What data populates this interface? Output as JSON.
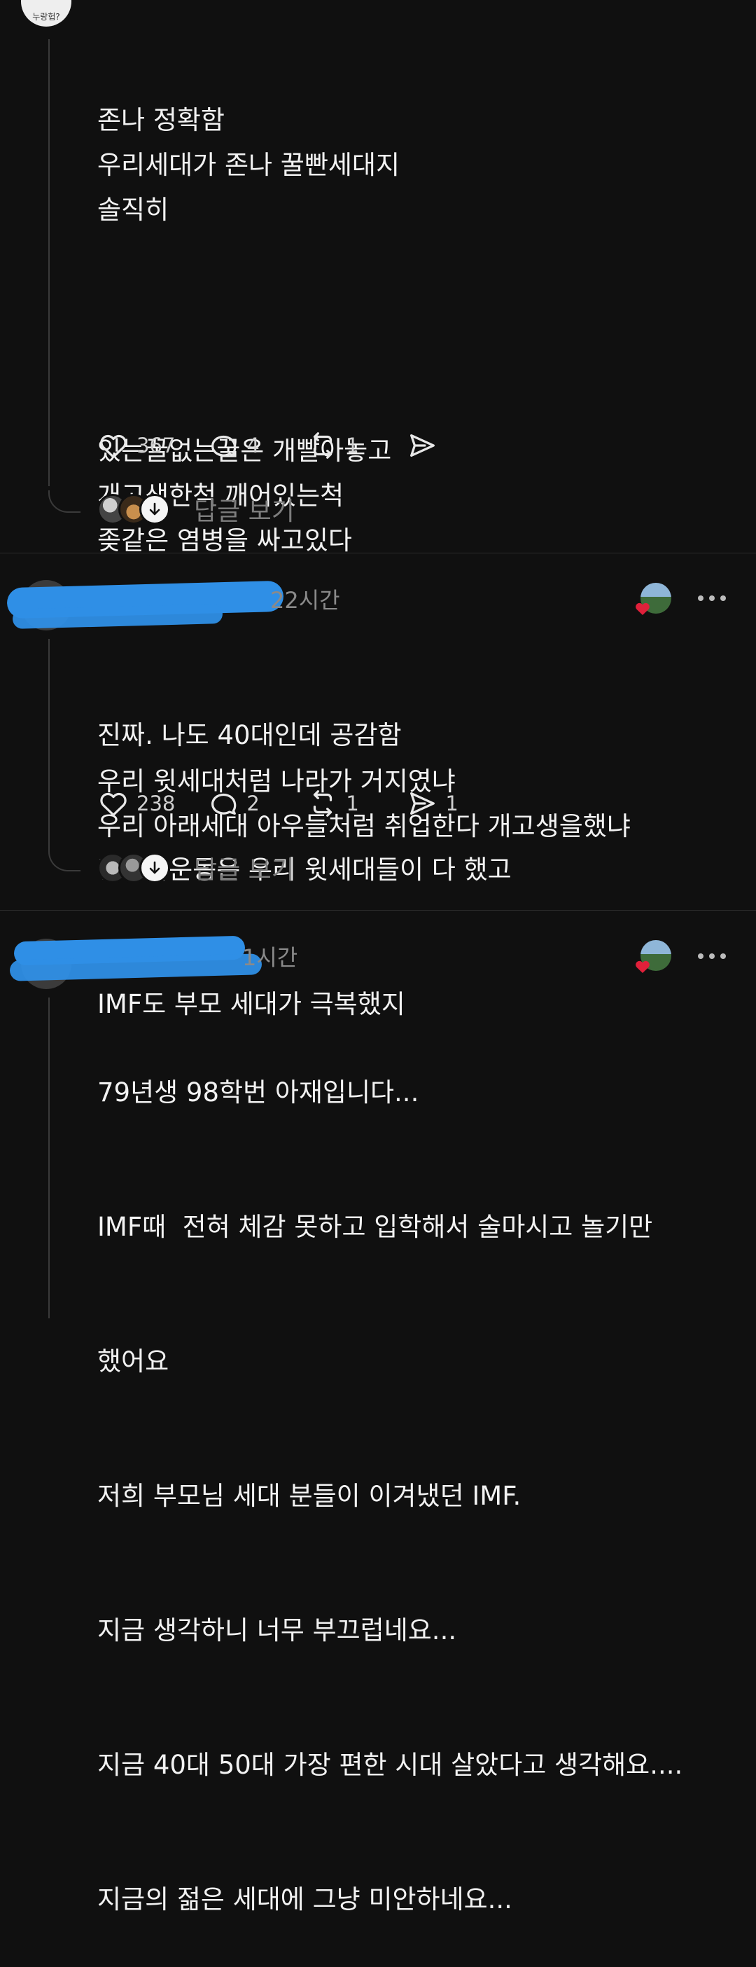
{
  "posts": [
    {
      "avatar_text": "누랑헙?",
      "time": "",
      "paragraphs": [
        [
          "존나 정확함",
          "우리세대가 존나 꿀빤세대지",
          "솔직히"
        ],
        [
          "있는꿀없는꿀은 개빨아놓고",
          "개고생한척 깨어있는척",
          "좆같은 염병을 싸고있다"
        ],
        [
          "우리 윗세대처럼 나라가 거지였냐",
          "우리 아래세대 아우들처럼 취업한다 개고생을했냐"
        ]
      ],
      "likes": "367",
      "comments": "4",
      "reposts": "1",
      "shares": "",
      "view_replies": "답글 보기"
    },
    {
      "time": "22시간",
      "paragraphs": [
        [
          "진짜. 나도 40대인데 공감함",
          "민주화운동은 우리 윗세대들이 다 했고",
          "IMF도 부모 세대가 극복했지"
        ]
      ],
      "likes": "238",
      "comments": "2",
      "reposts": "1",
      "shares": "1",
      "view_replies": "답글 보기"
    },
    {
      "time": "1시간",
      "paragraphs": [
        [
          "79년생 98학번 아재입니다...",
          "IMF때  전혀 체감 못하고 입학해서 술마시고 놀기만",
          "했어요",
          "저희 부모님 세대 분들이 이겨냈던 IMF.",
          "지금 생각하니 너무 부끄럽네요...",
          "지금 40대 50대 가장 편한 시대 살았다고 생각해요....",
          "지금의 젊은 세대에 그냥 미안하네요..."
        ]
      ]
    }
  ],
  "colors": {
    "background": "#101010",
    "redaction": "#2f8fe6",
    "heart_badge": "#e0203a"
  }
}
